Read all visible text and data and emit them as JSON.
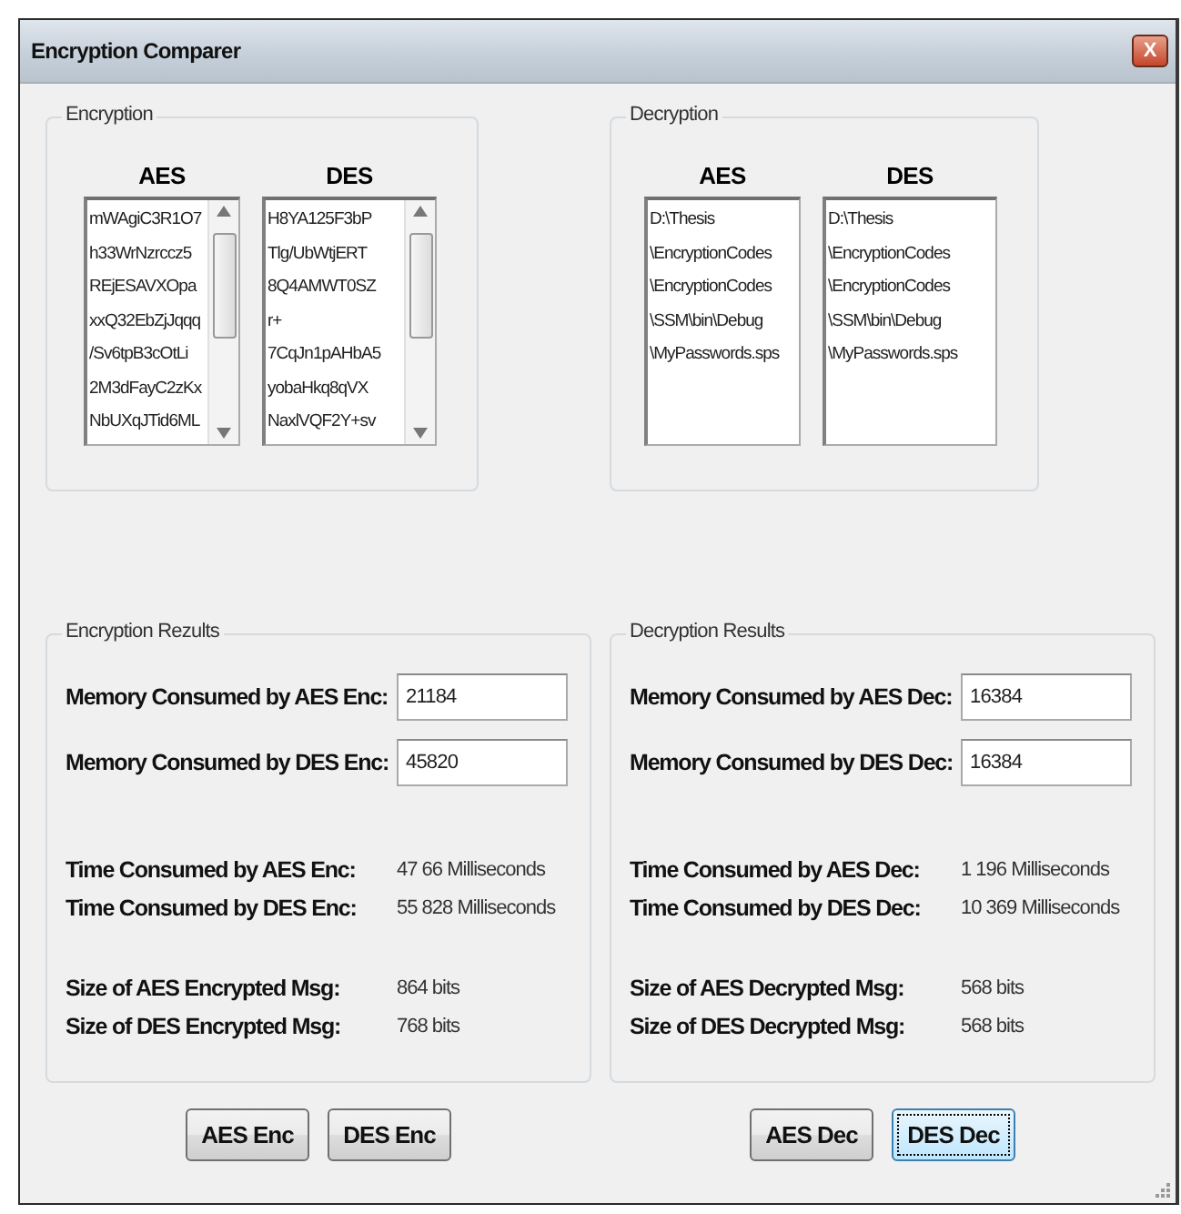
{
  "window": {
    "title": "Encryption Comparer",
    "close": "X"
  },
  "top_groups": [
    {
      "title": "Encryption",
      "boxes": [
        {
          "label": "AES",
          "scrollable": true,
          "lines": [
            "mWAgiC3R1O7",
            "h33WrNzrccz5",
            "REjESAVXOpa",
            "xxQ32EbZjJqqq",
            "/Sv6tpB3cOtLi",
            "2M3dFayC2zKx",
            "NbUXqJTid6ML"
          ]
        },
        {
          "label": "DES",
          "scrollable": true,
          "lines": [
            "H8YA125F3bP",
            "Tlg/UbWtjERT",
            "8Q4AMWT0SZ",
            "r+",
            "7CqJn1pAHbA5",
            "yobaHkq8qVX",
            "NaxlVQF2Y+sv"
          ]
        }
      ]
    },
    {
      "title": "Decryption",
      "boxes": [
        {
          "label": "AES",
          "scrollable": false,
          "lines": [
            "D:\\Thesis",
            "\\EncryptionCodes",
            "\\EncryptionCodes",
            "\\SSM\\bin\\Debug",
            "\\MyPasswords.sps"
          ]
        },
        {
          "label": "DES",
          "scrollable": false,
          "lines": [
            "D:\\Thesis",
            "\\EncryptionCodes",
            "\\EncryptionCodes",
            "\\SSM\\bin\\Debug",
            "\\MyPasswords.sps"
          ]
        }
      ]
    }
  ],
  "results": [
    {
      "title": "Encryption Rezults",
      "memory": [
        {
          "label": "Memory Consumed by AES Enc:",
          "value": "21184"
        },
        {
          "label": "Memory Consumed by DES Enc:",
          "value": "45820"
        }
      ],
      "times": [
        {
          "label": "Time Consumed by AES Enc:",
          "value": "47 66 Milliseconds"
        },
        {
          "label": "Time Consumed by DES Enc:",
          "value": "55 828 Milliseconds"
        }
      ],
      "sizes": [
        {
          "label": "Size of AES Encrypted Msg:",
          "value": "864 bits"
        },
        {
          "label": "Size of DES Encrypted Msg:",
          "value": "768 bits"
        }
      ],
      "buttons": [
        {
          "label": "AES Enc",
          "focused": false
        },
        {
          "label": "DES Enc",
          "focused": false
        }
      ]
    },
    {
      "title": "Decryption Results",
      "memory": [
        {
          "label": "Memory Consumed by AES Dec:",
          "value": "16384"
        },
        {
          "label": "Memory Consumed by DES Dec:",
          "value": "16384"
        }
      ],
      "times": [
        {
          "label": "Time Consumed by AES Dec:",
          "value": "1 196 Milliseconds"
        },
        {
          "label": "Time Consumed by DES Dec:",
          "value": "10 369 Milliseconds"
        }
      ],
      "sizes": [
        {
          "label": "Size of AES Decrypted Msg:",
          "value": "568 bits"
        },
        {
          "label": "Size of DES Decrypted Msg:",
          "value": "568 bits"
        }
      ],
      "buttons": [
        {
          "label": "AES Dec",
          "focused": false
        },
        {
          "label": "DES Dec",
          "focused": true
        }
      ]
    }
  ]
}
